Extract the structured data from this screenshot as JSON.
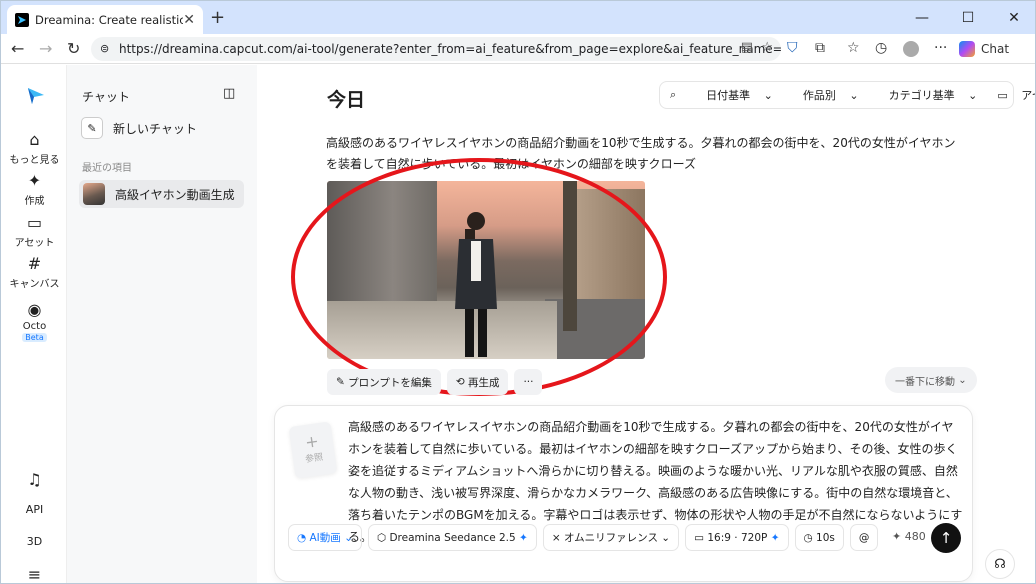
{
  "browser": {
    "tab_title": "Dreamina: Create realistic talking a",
    "tab_close": "✕",
    "new_tab": "+",
    "url": "https://dreamina.capcut.com/ai-tool/generate?enter_from=ai_feature&from_page=explore&ai_feature_name=video&wor...",
    "chat_label": "Chat",
    "minimize": "—",
    "maximize": "☐",
    "close": "✕"
  },
  "rail": {
    "more_label": "もっと見る",
    "create_label": "作成",
    "asset_label": "アセット",
    "canvas_label": "キャンバス",
    "octo_label": "Octo",
    "octo_badge": "Beta",
    "api_label": "API",
    "threed_label": "3D"
  },
  "panel": {
    "title": "チャット",
    "new_chat": "新しいチャット",
    "recent_header": "最近の項目",
    "recent_item": "高級イヤホン動画生成"
  },
  "main": {
    "title": "今日",
    "filters": [
      "日付基準",
      "作品別",
      "カテゴリ基準",
      "アセット"
    ],
    "prompt_text": "高級感のあるワイヤレスイヤホンの商品紹介動画を10秒で生成する。夕暮れの都会の街中を、20代の女性がイヤホンを装着して自然に歩いている。最初はイヤホンの細部を映すクローズ",
    "edit_prompt": "プロンプトを編集",
    "regenerate": "再生成",
    "more": "···",
    "scroll_bottom": "一番下に移動"
  },
  "composer": {
    "ref_label": "参照",
    "text": "高級感のあるワイヤレスイヤホンの商品紹介動画を10秒で生成する。夕暮れの都会の街中を、20代の女性がイヤホンを装着して自然に歩いている。最初はイヤホンの細部を映すクローズアップから始まり、その後、女性の歩く姿を追従するミディアムショットへ滑らかに切り替える。映画のような暖かい光、リアルな肌や衣服の質感、自然な人物の動き、浅い被写界深度、滑らかなカメラワーク、高級感のある広告映像にする。街中の自然な環境音と、落ち着いたテンポのBGMを加える。字幕やロゴは表示せず、物体の形状や人物の手足が不自然にならないようにする。",
    "mode": "AI動画",
    "model": "Dreamina Seedance 2.5",
    "reference_mode": "オムニリファレンス",
    "ratio": "16:9",
    "resolution": "720P",
    "duration": "10s",
    "at": "@",
    "credits": "480"
  },
  "colors": {
    "accent": "#1677ff",
    "highlight_circle": "#e5161b"
  }
}
